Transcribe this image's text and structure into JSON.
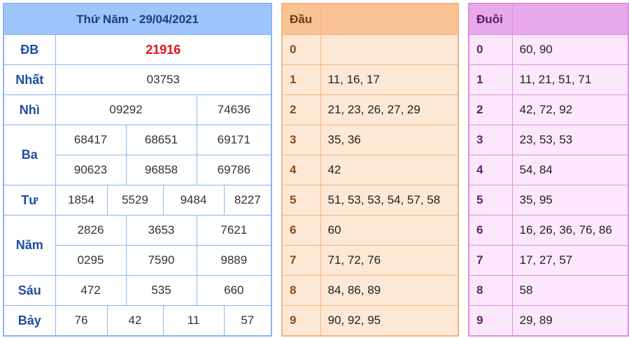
{
  "results": {
    "header": "Thứ Năm - 29/04/2021",
    "rows": [
      {
        "label": "ĐB",
        "values": [
          "21916"
        ]
      },
      {
        "label": "Nhất",
        "values": [
          "03753"
        ]
      },
      {
        "label": "Nhì",
        "values": [
          "09292",
          "74636"
        ]
      },
      {
        "label": "Ba",
        "values": [
          "68417",
          "68651",
          "69171",
          "90623",
          "96858",
          "69786"
        ]
      },
      {
        "label": "Tư",
        "values": [
          "1854",
          "5529",
          "9484",
          "8227"
        ]
      },
      {
        "label": "Năm",
        "values": [
          "2826",
          "3653",
          "7621",
          "0295",
          "7590",
          "9889"
        ]
      },
      {
        "label": "Sáu",
        "values": [
          "472",
          "535",
          "660"
        ]
      },
      {
        "label": "Bảy",
        "values": [
          "76",
          "42",
          "11",
          "57"
        ]
      }
    ]
  },
  "dau": {
    "header": "Đầu",
    "rows": [
      {
        "key": "0",
        "value": ""
      },
      {
        "key": "1",
        "value": "11, 16, 17"
      },
      {
        "key": "2",
        "value": "21, 23, 26, 27, 29"
      },
      {
        "key": "3",
        "value": "35, 36"
      },
      {
        "key": "4",
        "value": "42"
      },
      {
        "key": "5",
        "value": "51, 53, 53, 54, 57, 58"
      },
      {
        "key": "6",
        "value": "60"
      },
      {
        "key": "7",
        "value": "71, 72, 76"
      },
      {
        "key": "8",
        "value": "84, 86, 89"
      },
      {
        "key": "9",
        "value": "90, 92, 95"
      }
    ]
  },
  "duoi": {
    "header": "Đuôi",
    "rows": [
      {
        "key": "0",
        "value": "60, 90"
      },
      {
        "key": "1",
        "value": "11, 21, 51, 71"
      },
      {
        "key": "2",
        "value": "42, 72, 92"
      },
      {
        "key": "3",
        "value": "23, 53, 53"
      },
      {
        "key": "4",
        "value": "54, 84"
      },
      {
        "key": "5",
        "value": "35, 95"
      },
      {
        "key": "6",
        "value": "16, 26, 36, 76, 86"
      },
      {
        "key": "7",
        "value": "17, 27, 57"
      },
      {
        "key": "8",
        "value": "58"
      },
      {
        "key": "9",
        "value": "29, 89"
      }
    ]
  },
  "colors": {
    "results_border": "#89b6f2",
    "dau_border": "#f7b47b",
    "duoi_border": "#dd8fe1",
    "special_prize": "#e0141e"
  }
}
